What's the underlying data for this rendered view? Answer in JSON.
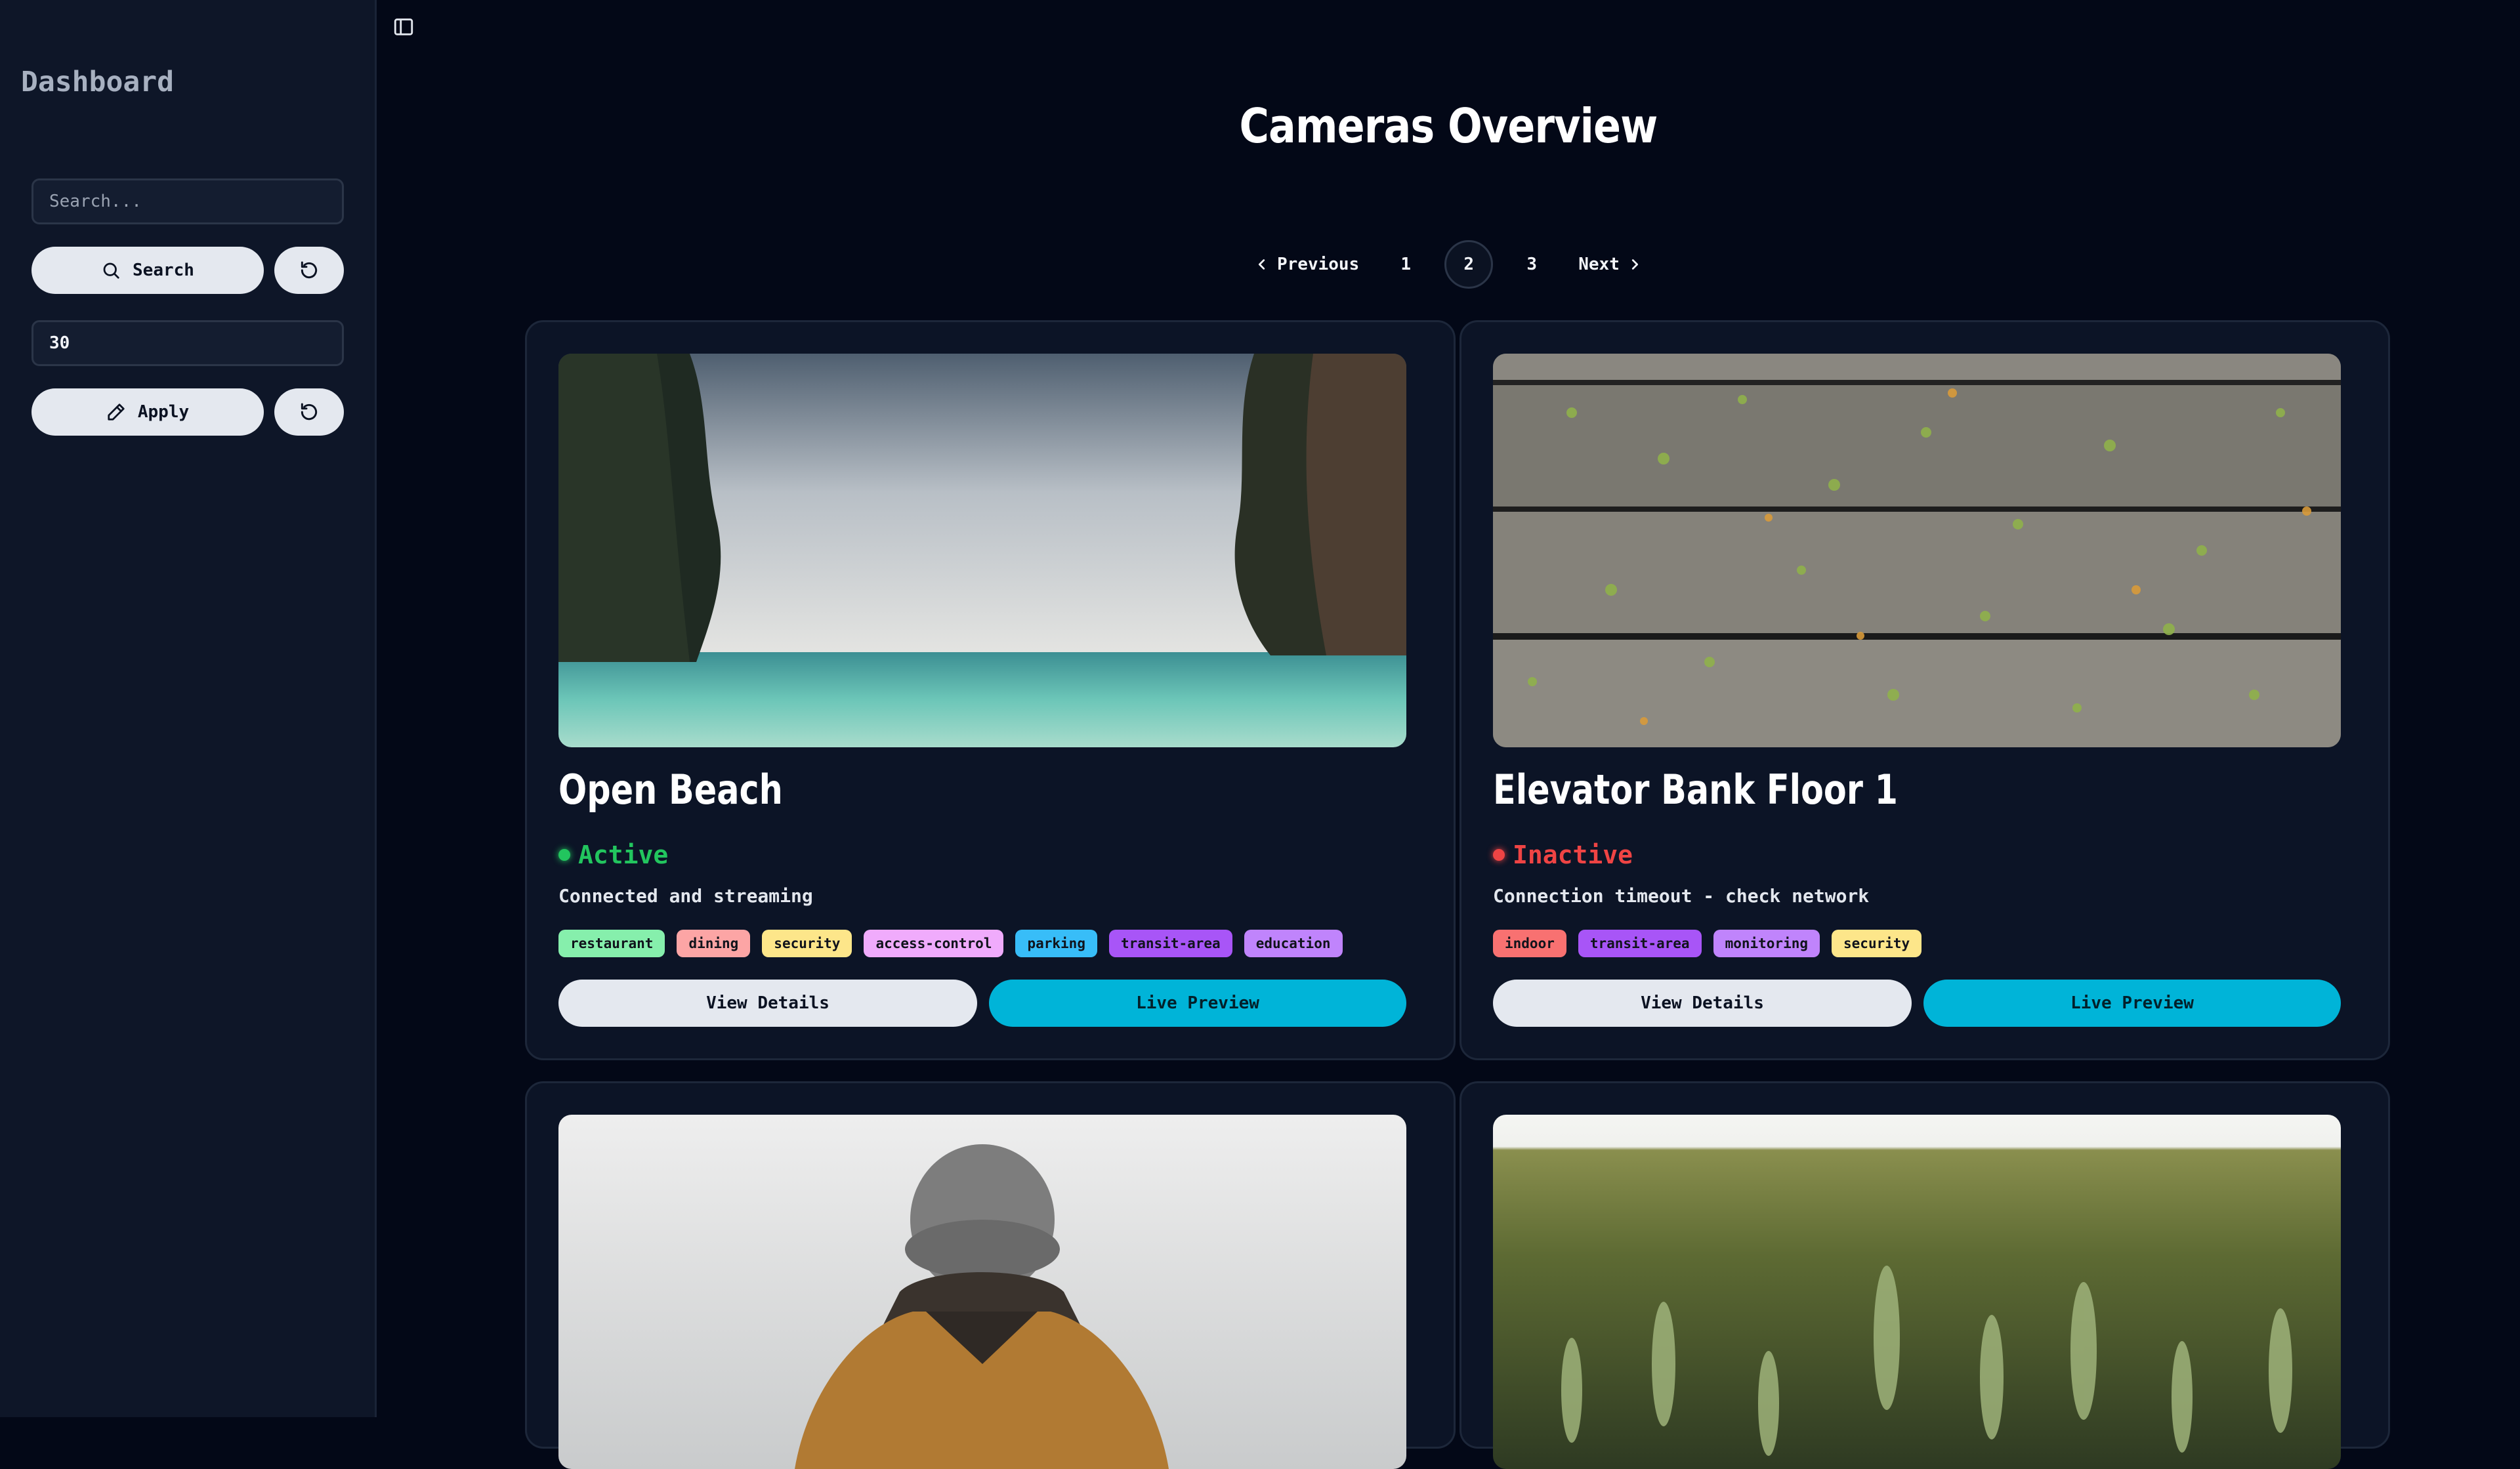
{
  "sidebar": {
    "brand": "Dashboard",
    "search_placeholder": "Search...",
    "search_label": "Search",
    "limit_value": "30",
    "apply_label": "Apply"
  },
  "main": {
    "title": "Cameras Overview",
    "pagination": {
      "previous": "Previous",
      "pages": [
        "1",
        "2",
        "3"
      ],
      "current": "2",
      "next": "Next"
    }
  },
  "cards": [
    {
      "name": "Open Beach",
      "status": "Active",
      "status_color": "#22c55e",
      "description": "Connected and streaming",
      "tags": [
        {
          "label": "restaurant",
          "color": "#86efac"
        },
        {
          "label": "dining",
          "color": "#fca5a5"
        },
        {
          "label": "security",
          "color": "#fde68a"
        },
        {
          "label": "access-control",
          "color": "#f0abfc"
        },
        {
          "label": "parking",
          "color": "#38bdf8"
        },
        {
          "label": "transit-area",
          "color": "#a855f7"
        },
        {
          "label": "education",
          "color": "#c084fc"
        }
      ],
      "details_label": "View Details",
      "preview_label": "Live Preview"
    },
    {
      "name": "Elevator Bank Floor 1",
      "status": "Inactive",
      "status_color": "#ef4444",
      "description": "Connection timeout - check network",
      "tags": [
        {
          "label": "indoor",
          "color": "#f87171"
        },
        {
          "label": "transit-area",
          "color": "#a855f7"
        },
        {
          "label": "monitoring",
          "color": "#c084fc"
        },
        {
          "label": "security",
          "color": "#fde68a"
        }
      ],
      "details_label": "View Details",
      "preview_label": "Live Preview"
    }
  ]
}
